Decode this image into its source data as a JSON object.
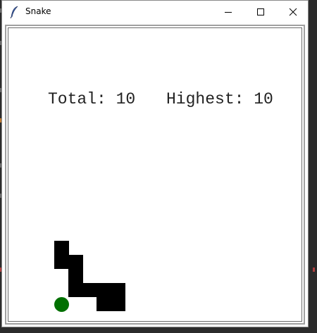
{
  "window": {
    "title": "Snake",
    "icon": "feather-icon"
  },
  "controls": {
    "minimize_icon": "minimize-icon",
    "maximize_icon": "maximize-icon",
    "close_icon": "close-icon"
  },
  "scoreboard": {
    "total_text": "Total: 10",
    "highest_text": "Highest: 10",
    "total": 10,
    "highest": 10
  },
  "colors": {
    "snake": "#000000",
    "food": "#007000",
    "background": "#ffffff"
  }
}
